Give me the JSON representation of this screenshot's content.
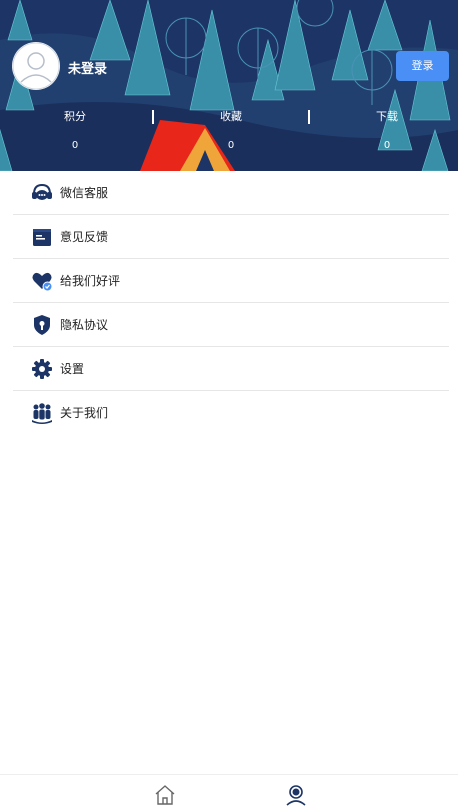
{
  "header": {
    "username": "未登录",
    "login_label": "登录",
    "stats": [
      {
        "label": "积分",
        "value": "0"
      },
      {
        "label": "收藏",
        "value": "0"
      },
      {
        "label": "下载",
        "value": "0"
      }
    ]
  },
  "menu": [
    {
      "label": "微信客服",
      "icon": "customer-service-icon"
    },
    {
      "label": "意见反馈",
      "icon": "feedback-icon"
    },
    {
      "label": "给我们好评",
      "icon": "heart-check-icon"
    },
    {
      "label": "隐私协议",
      "icon": "shield-icon"
    },
    {
      "label": "设置",
      "icon": "gear-icon"
    },
    {
      "label": "关于我们",
      "icon": "people-icon"
    }
  ],
  "tabbar": {
    "items": [
      {
        "icon": "home-icon",
        "active": false
      },
      {
        "icon": "profile-icon",
        "active": true
      }
    ]
  },
  "colors": {
    "header_bg": "#1d3566",
    "accent": "#4a8ff5",
    "icon": "#1d3566"
  }
}
